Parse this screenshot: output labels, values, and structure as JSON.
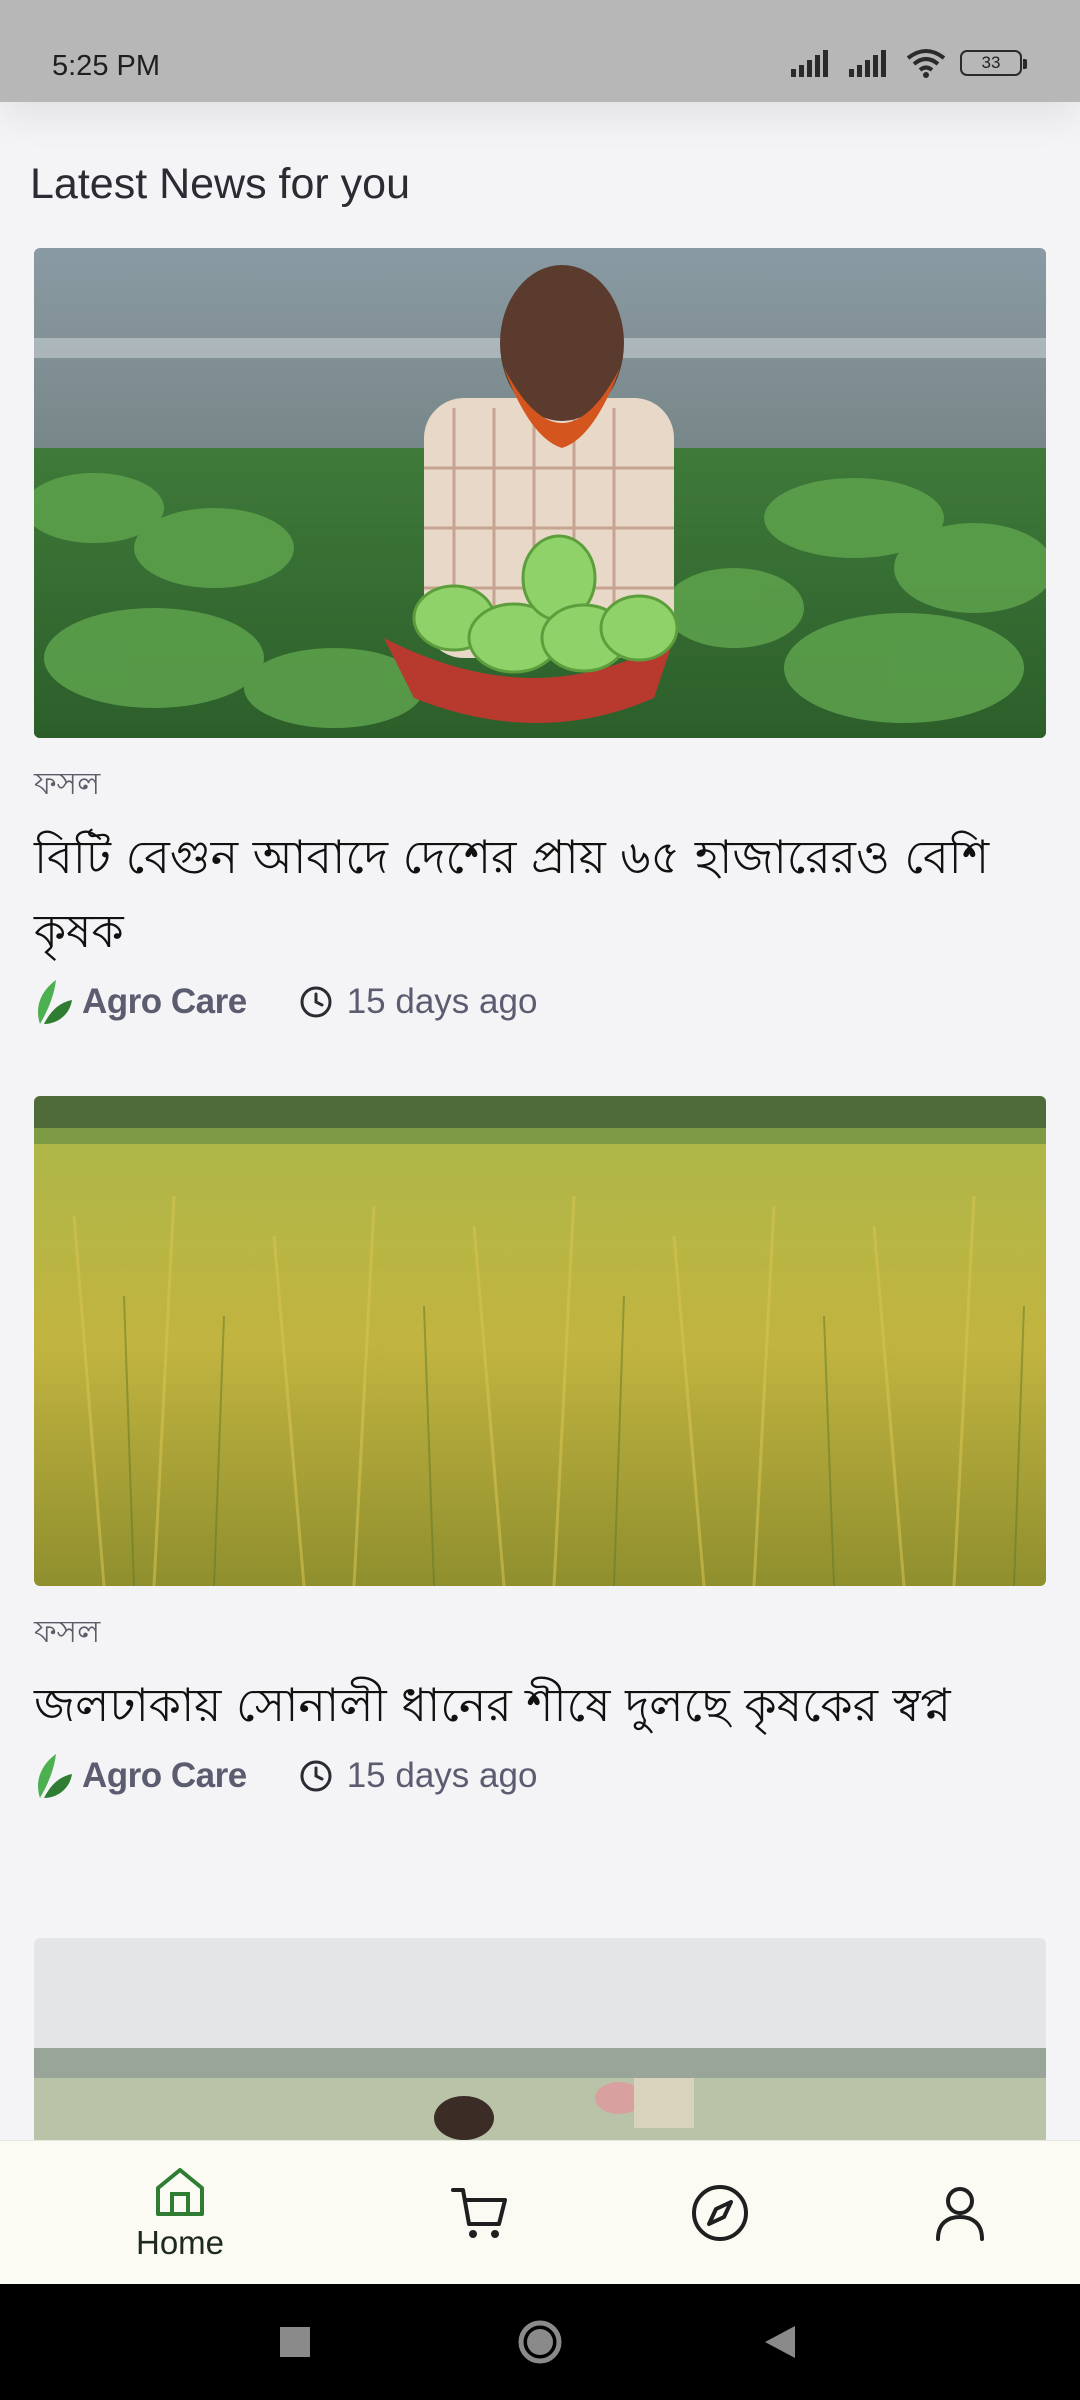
{
  "status_bar": {
    "time": "5:25 PM",
    "battery": "33",
    "icons": [
      "signal-icon",
      "signal-icon",
      "wifi-icon",
      "battery-icon"
    ]
  },
  "section_title": "Latest News for you",
  "articles": [
    {
      "category": "ফসল",
      "title": "বিটি বেগুন আবাদে দেশের প্রায় ৬৫ হাজারেরও বেশি কৃষক",
      "source": "Agro Care",
      "time": "15 days ago",
      "image": "farmer-with-eggplant-basket"
    },
    {
      "category": "ফসল",
      "title": "জলঢাকায় সোনালী ধানের শীষে দুলছে কৃষকের স্বপ্ন",
      "source": "Agro Care",
      "time": "15 days ago",
      "image": "golden-rice-field"
    },
    {
      "image": "farmers-in-field"
    }
  ],
  "bottom_nav": {
    "items": [
      {
        "label": "Home",
        "icon": "home-icon",
        "active": true
      },
      {
        "label": "",
        "icon": "cart-icon",
        "active": false
      },
      {
        "label": "",
        "icon": "compass-icon",
        "active": false
      },
      {
        "label": "",
        "icon": "profile-icon",
        "active": false
      }
    ]
  },
  "colors": {
    "accent": "#2e7d32",
    "text_muted": "#5b5c70",
    "background": "#f4f4f6"
  }
}
